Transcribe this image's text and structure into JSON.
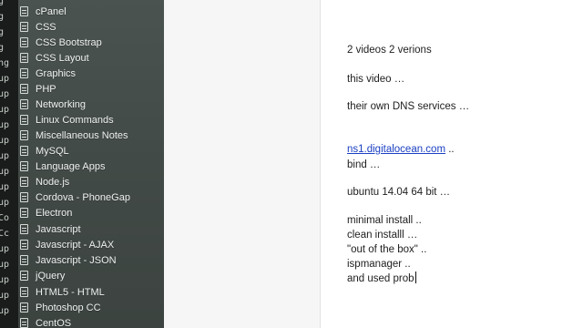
{
  "terminal": {
    "lines": [
      "g",
      "g",
      "g",
      "g",
      "ng",
      "up",
      "up",
      "up",
      "up",
      "up",
      "up",
      "up",
      "up",
      "up",
      "Co",
      "Cc",
      "up",
      "up",
      "up",
      "up",
      "up"
    ]
  },
  "sidebar": {
    "items": [
      {
        "label": "cPanel",
        "icon": "note-icon"
      },
      {
        "label": "CSS",
        "icon": "note-icon"
      },
      {
        "label": "CSS Bootstrap",
        "icon": "note-icon"
      },
      {
        "label": "CSS Layout",
        "icon": "note-icon"
      },
      {
        "label": "Graphics",
        "icon": "note-icon"
      },
      {
        "label": "PHP",
        "icon": "note-icon"
      },
      {
        "label": "Networking",
        "icon": "note-icon"
      },
      {
        "label": "Linux Commands",
        "icon": "note-icon"
      },
      {
        "label": "Miscellaneous Notes",
        "icon": "note-icon"
      },
      {
        "label": "MySQL",
        "icon": "note-icon"
      },
      {
        "label": "Language Apps",
        "icon": "note-icon"
      },
      {
        "label": "Node.js",
        "icon": "note-icon"
      },
      {
        "label": "Cordova - PhoneGap",
        "icon": "note-icon"
      },
      {
        "label": "Electron",
        "icon": "note-icon"
      },
      {
        "label": "Javascript",
        "icon": "note-icon"
      },
      {
        "label": "Javascript - AJAX",
        "icon": "note-icon"
      },
      {
        "label": "Javascript - JSON",
        "icon": "note-icon"
      },
      {
        "label": "jQuery",
        "icon": "note-icon"
      },
      {
        "label": "HTML5 - HTML",
        "icon": "note-icon"
      },
      {
        "label": "Photoshop CC",
        "icon": "note-icon"
      },
      {
        "label": "CentOS",
        "icon": "note-icon"
      }
    ]
  },
  "editor": {
    "lines": {
      "l1": "2 videos 2 verions",
      "l2": "this video …",
      "l3": "their own DNS services …",
      "l4_link": "ns1.digitalocean.com",
      "l4_rest": " ..",
      "l5": "bind …",
      "l6": "ubuntu 14.04 64 bit …",
      "l7": "minimal install ..",
      "l8": "clean installl …",
      "l9": "\"out of the box\" ..",
      "l10": "ispmanager ..",
      "l11": "and used prob"
    }
  },
  "colors": {
    "sidebar_bg": "#444c49",
    "terminal_bg": "#1a1c1c",
    "link": "#1a3fc2"
  }
}
